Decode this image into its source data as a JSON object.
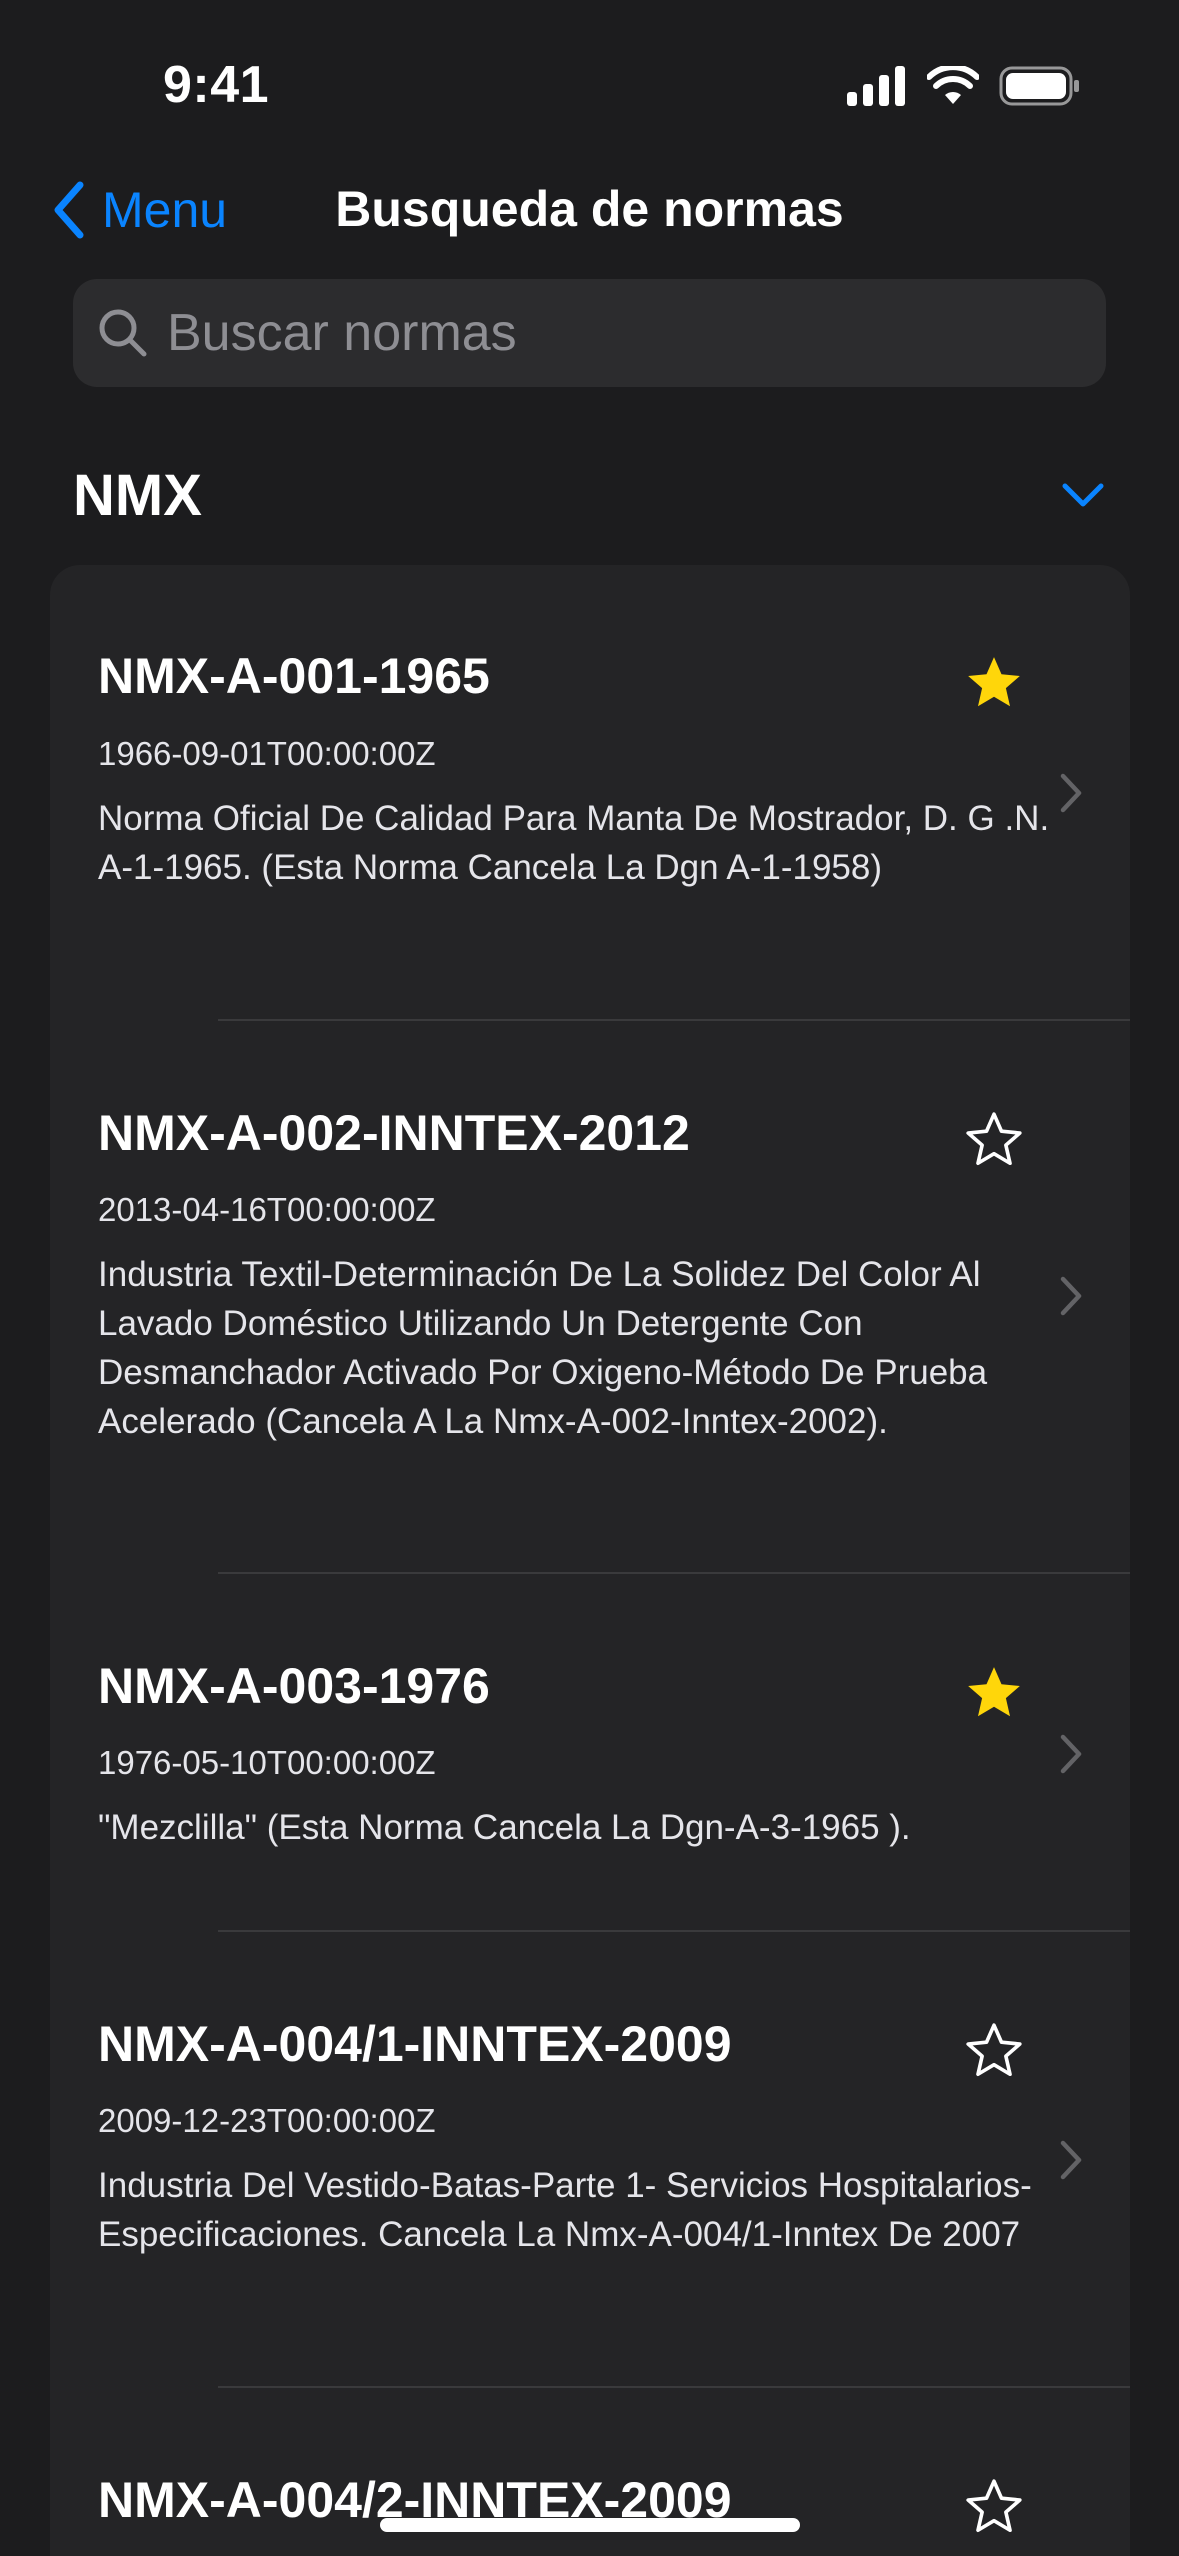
{
  "status_bar": {
    "time": "9:41"
  },
  "nav": {
    "back_label": "Menu",
    "title": "Busqueda de normas"
  },
  "search": {
    "placeholder": "Buscar normas",
    "value": ""
  },
  "section": {
    "title": "NMX",
    "expanded": true
  },
  "colors": {
    "accent": "#0a84ff",
    "star_filled": "#ffd60a"
  },
  "items": [
    {
      "code": "NMX-A-001-1965",
      "date": "1966-09-01T00:00:00Z",
      "description": "Norma Oficial De Calidad Para Manta De Mostrador, D. G .N. A-1-1965. (Esta Norma Cancela La Dgn A-1-1958)",
      "favorite": true,
      "star_icon": "star-filled-icon"
    },
    {
      "code": "NMX-A-002-INNTEX-2012",
      "date": "2013-04-16T00:00:00Z",
      "description": "Industria Textil-Determinación De La Solidez Del Color Al Lavado Doméstico Utilizando Un Detergente Con Desmanchador Activado Por Oxigeno-Método De Prueba Acelerado (Cancela A La Nmx-A-002-Inntex-2002).",
      "favorite": false,
      "star_icon": "star-outline-icon"
    },
    {
      "code": "NMX-A-003-1976",
      "date": "1976-05-10T00:00:00Z",
      "description": "\"Mezclilla\" (Esta Norma Cancela La Dgn-A-3-1965 ).",
      "favorite": true,
      "star_icon": "star-filled-icon"
    },
    {
      "code": "NMX-A-004/1-INNTEX-2009",
      "date": "2009-12-23T00:00:00Z",
      "description": "Industria Del Vestido-Batas-Parte 1- Servicios Hospitalarios-Especificaciones. Cancela La Nmx-A-004/1-Inntex De 2007",
      "favorite": false,
      "star_icon": "star-outline-icon"
    },
    {
      "code": "NMX-A-004/2-INNTEX-2009",
      "favorite": false,
      "star_icon": "star-outline-icon"
    }
  ]
}
